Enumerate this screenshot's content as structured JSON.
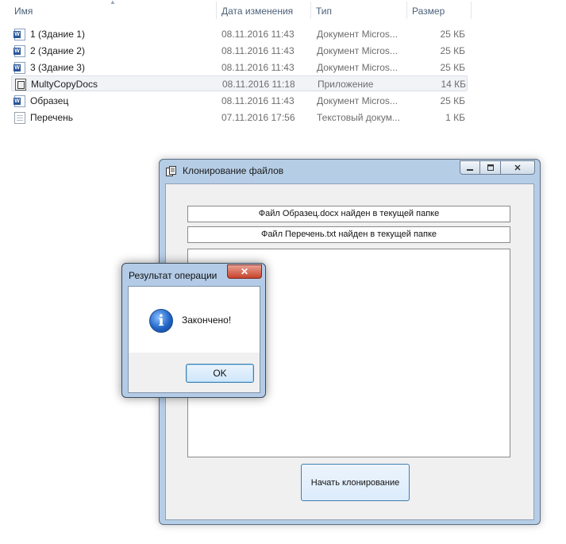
{
  "explorer": {
    "columns": {
      "name": "Имя",
      "date": "Дата изменения",
      "type": "Тип",
      "size": "Размер"
    },
    "files": [
      {
        "name": "1 (Здание 1)",
        "date": "08.11.2016 11:43",
        "type": "Документ Micros...",
        "size": "25 КБ",
        "icon": "word-document-icon"
      },
      {
        "name": "2 (Здание 2)",
        "date": "08.11.2016 11:43",
        "type": "Документ Micros...",
        "size": "25 КБ",
        "icon": "word-document-icon"
      },
      {
        "name": "3 (Здание 3)",
        "date": "08.11.2016 11:43",
        "type": "Документ Micros...",
        "size": "25 КБ",
        "icon": "word-document-icon"
      },
      {
        "name": "MultyCopyDocs",
        "date": "08.11.2016 11:18",
        "type": "Приложение",
        "size": "14 КБ",
        "icon": "application-icon"
      },
      {
        "name": "Образец",
        "date": "08.11.2016 11:43",
        "type": "Документ Micros...",
        "size": "25 КБ",
        "icon": "word-document-icon"
      },
      {
        "name": "Перечень",
        "date": "07.11.2016 17:56",
        "type": "Текстовый докум...",
        "size": "1 КБ",
        "icon": "text-document-icon"
      }
    ]
  },
  "clone_window": {
    "title": "Клонирование файлов",
    "status_lines": [
      "Файл Образец.docx найден в текущей папке",
      "Файл Перечень.txt найден в текущей папке"
    ],
    "start_button": "Начать клонирование"
  },
  "message_box": {
    "title": "Результат операции",
    "message": "Закончено!",
    "ok_button": "OK",
    "close_glyph": "✕",
    "icon": "information-icon"
  }
}
